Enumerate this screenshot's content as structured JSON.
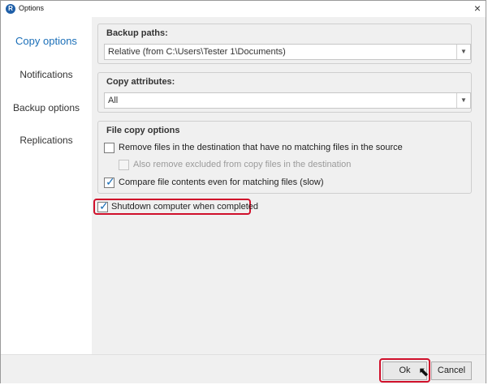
{
  "window": {
    "title": "Options",
    "app_icon": "R"
  },
  "icons": {
    "close": "×",
    "dropdown_arrow": "▼",
    "check": "✓",
    "cursor": "⬉"
  },
  "sidebar": {
    "items": [
      {
        "label": "Copy options",
        "active": true
      },
      {
        "label": "Notifications",
        "active": false
      },
      {
        "label": "Backup options",
        "active": false
      },
      {
        "label": "Replications",
        "active": false
      }
    ]
  },
  "backup_paths": {
    "title": "Backup paths:",
    "selected": "Relative (from C:\\Users\\Tester 1\\Documents)"
  },
  "copy_attributes": {
    "title": "Copy attributes:",
    "selected": "All"
  },
  "file_copy_options": {
    "title": "File copy options",
    "remove_unmatched": {
      "label": "Remove files in the destination that have no matching files in the source",
      "checked": false
    },
    "also_remove_excluded": {
      "label": "Also remove excluded from copy files in the destination",
      "checked": false,
      "disabled": true
    },
    "compare_contents": {
      "label": "Compare file contents even for matching files (slow)",
      "checked": true
    }
  },
  "shutdown": {
    "label": "Shutdown computer when completed",
    "checked": true
  },
  "footer": {
    "ok_label": "Ok",
    "cancel_label": "Cancel"
  },
  "colors": {
    "accent": "#1b6fb8",
    "highlight": "#d0102b",
    "panel": "#f0f0f0"
  }
}
